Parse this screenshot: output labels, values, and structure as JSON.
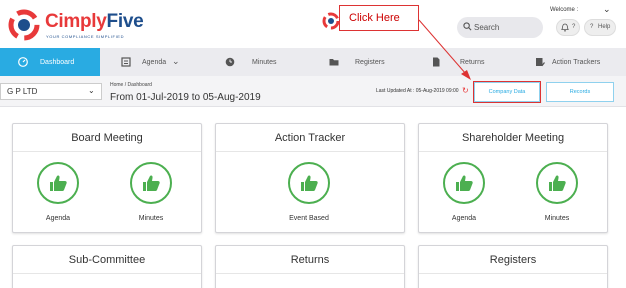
{
  "header": {
    "logo_left": "Cimply",
    "logo_right": "Five",
    "logo_tagline": "YOUR COMPLIANCE SIMPLIFIED",
    "welcome": "Welcome :",
    "search_placeholder": "Search",
    "notif_label": "?",
    "help_label": "Help"
  },
  "nav": {
    "items": [
      {
        "label": "Dashboard",
        "icon": "dashboard-icon"
      },
      {
        "label": "Agenda",
        "icon": "agenda-icon"
      },
      {
        "label": "Minutes",
        "icon": "clock-icon"
      },
      {
        "label": "Registers",
        "icon": "folder-icon"
      },
      {
        "label": "Returns",
        "icon": "document-icon"
      },
      {
        "label": "Action Trackers",
        "icon": "tracker-icon"
      }
    ]
  },
  "subheader": {
    "company": "G P LTD",
    "breadcrumb": "Home  /  Dashboard",
    "date_range": "From 01-Jul-2019 to 05-Aug-2019",
    "last_updated": "Last Updated At : 05-Aug-2019 09:00",
    "company_data_button": "Company Data",
    "records_button": "Records"
  },
  "annotation": {
    "text": "Click Here"
  },
  "cards": [
    {
      "title": "Board Meeting",
      "items": [
        "Agenda",
        "Minutes"
      ]
    },
    {
      "title": "Action Tracker",
      "items": [
        "Event Based"
      ]
    },
    {
      "title": "Shareholder Meeting",
      "items": [
        "Agenda",
        "Minutes"
      ]
    },
    {
      "title": "Sub-Committee"
    },
    {
      "title": "Returns"
    },
    {
      "title": "Registers"
    }
  ],
  "colors": {
    "accent": "#29abe2",
    "brand_red": "#e8393a",
    "brand_blue": "#1e4e8c",
    "success": "#4caf50"
  }
}
